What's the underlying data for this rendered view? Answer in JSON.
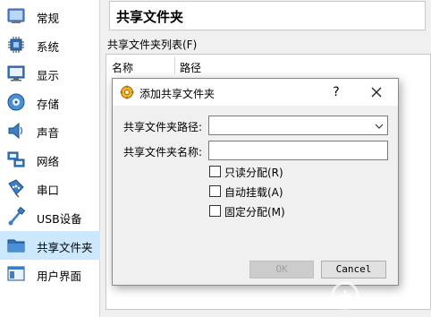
{
  "sidebar": {
    "items": [
      {
        "label": "常规",
        "icon": "general-icon"
      },
      {
        "label": "系统",
        "icon": "system-chip-icon"
      },
      {
        "label": "显示",
        "icon": "display-monitor-icon"
      },
      {
        "label": "存储",
        "icon": "storage-disk-icon"
      },
      {
        "label": "声音",
        "icon": "speaker-icon"
      },
      {
        "label": "网络",
        "icon": "network-icon"
      },
      {
        "label": "串口",
        "icon": "serial-port-icon"
      },
      {
        "label": "USB设备",
        "icon": "usb-icon"
      },
      {
        "label": "共享文件夹",
        "icon": "shared-folder-icon",
        "selected": true
      },
      {
        "label": "用户界面",
        "icon": "user-interface-icon"
      }
    ],
    "selected_color": "#cce8ff"
  },
  "main": {
    "title": "共享文件夹",
    "list_label": "共享文件夹列表(F)",
    "columns": [
      "名称",
      "路径"
    ]
  },
  "dialog": {
    "title": "添加共享文件夹",
    "help_label": "?",
    "path_label": "共享文件夹路径:",
    "path_value": "",
    "name_label": "共享文件夹名称:",
    "name_value": "",
    "checkboxes": [
      {
        "label": "只读分配(R)",
        "checked": false
      },
      {
        "label": "自动挂载(A)",
        "checked": false
      },
      {
        "label": "固定分配(M)",
        "checked": false
      }
    ],
    "ok_label": "OK",
    "cancel_label": "Cancel",
    "ok_enabled": false
  }
}
